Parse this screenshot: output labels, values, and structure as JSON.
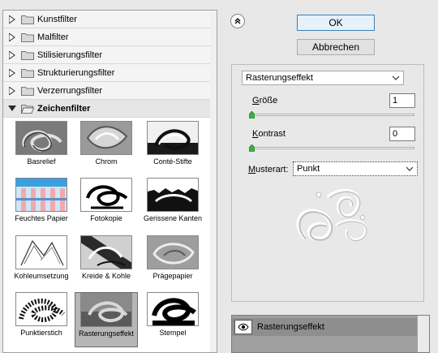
{
  "filter_gallery": {
    "categories": [
      {
        "label": "Kunstfilter",
        "open": false
      },
      {
        "label": "Malfilter",
        "open": false
      },
      {
        "label": "Stilisierungsfilter",
        "open": false
      },
      {
        "label": "Strukturierungsfilter",
        "open": false
      },
      {
        "label": "Verzerrungsfilter",
        "open": false
      },
      {
        "label": "Zeichenfilter",
        "open": true
      }
    ],
    "thumbnails": [
      {
        "label": "Basrelief"
      },
      {
        "label": "Chrom"
      },
      {
        "label": "Conté-Stifte"
      },
      {
        "label": "Feuchtes Papier"
      },
      {
        "label": "Fotokopie"
      },
      {
        "label": "Gerissene Kanten"
      },
      {
        "label": "Kohleumsetzung"
      },
      {
        "label": "Kreide & Kohle"
      },
      {
        "label": "Prägepapier"
      },
      {
        "label": "Punktierstich"
      },
      {
        "label": "Rasterungseffekt",
        "selected": true
      },
      {
        "label": "Stempel"
      }
    ]
  },
  "buttons": {
    "ok": "OK",
    "cancel": "Abbrechen"
  },
  "settings": {
    "filter_select": "Rasterungseffekt",
    "size_label_u": "G",
    "size_label_rest": "röße",
    "size_value": "1",
    "size_slider": 0.0,
    "contrast_label_u": "K",
    "contrast_label_rest": "ontrast",
    "contrast_value": "0",
    "contrast_slider": 0.0,
    "pattern_label_u": "M",
    "pattern_label_rest": "usterart:",
    "pattern_value": "Punkt"
  },
  "layers": {
    "active": "Rasterungseffekt"
  },
  "icons": {
    "collapse": "double-chevron-up-icon",
    "visibility": "eye-icon"
  }
}
